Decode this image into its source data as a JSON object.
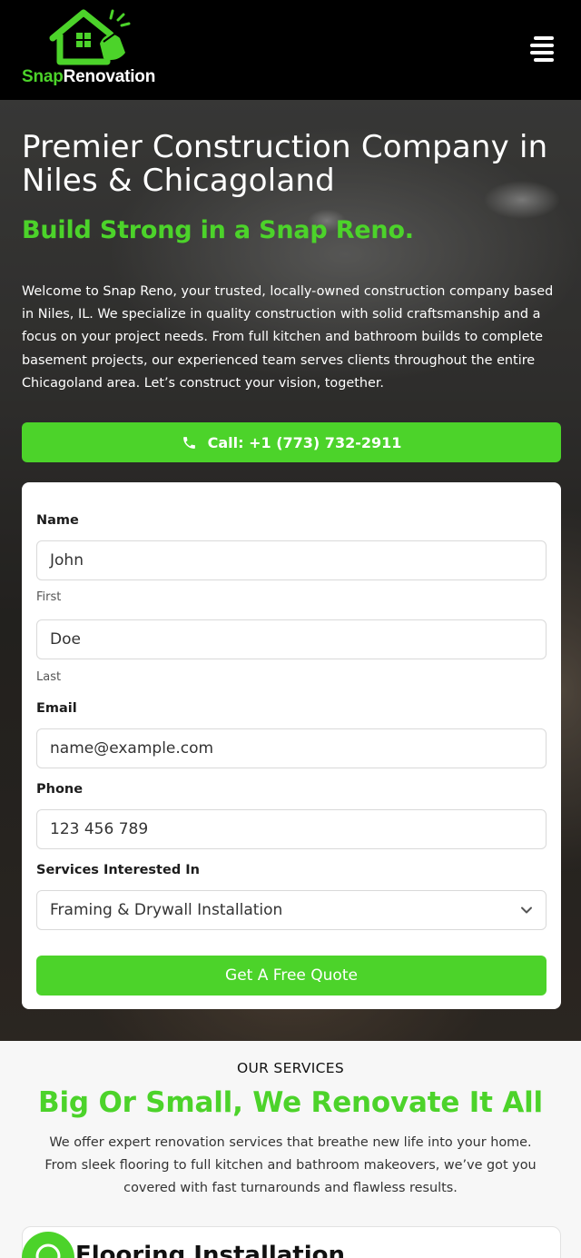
{
  "header": {
    "logo": {
      "part1": "Snap",
      "part2": "Renovation"
    },
    "menu_icon": "hamburger-menu-icon"
  },
  "hero": {
    "title": "Premier Construction Company in Niles & Chicagoland",
    "subtitle": "Build Strong in a Snap Reno.",
    "description": "Welcome to Snap Reno, your trusted, locally-owned construction company based in Niles, IL. We specialize in quality construction with solid craftsmanship and a focus on your project needs. From full kitchen and bathroom builds to complete basement projects, our experienced team serves clients throughout the entire Chicagoland area. Let’s construct your vision, together.",
    "call_button": "Call: +1 (773) 732-2911",
    "call_icon": "phone-icon"
  },
  "form": {
    "name_label": "Name",
    "first_value": "John",
    "first_sublabel": "First",
    "last_value": "Doe",
    "last_sublabel": "Last",
    "email_label": "Email",
    "email_value": "name@example.com",
    "phone_label": "Phone",
    "phone_value": "123 456 789",
    "services_label": "Services Interested In",
    "services_selected": "Framing & Drywall Installation",
    "submit": "Get A Free Quote"
  },
  "services": {
    "kicker": "OUR SERVICES",
    "title": "Big Or Small, We Renovate It All",
    "description": "We offer expert renovation services that breathe new life into your home. From sleek flooring to full kitchen and bathroom makeovers, we’ve got you covered with fast turnarounds and flawless results.",
    "first_card_title": "Flooring Installation"
  },
  "colors": {
    "accent": "#4cd32a",
    "header_bg": "#000000"
  }
}
